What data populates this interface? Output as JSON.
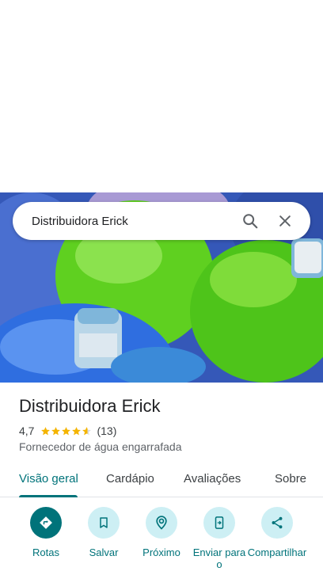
{
  "search": {
    "query": "Distribuidora Erick"
  },
  "place": {
    "name": "Distribuidora Erick",
    "rating": "4,7",
    "rating_value": 4.7,
    "review_count": "(13)",
    "category": "Fornecedor de água engarrafada"
  },
  "tabs": [
    {
      "label": "Visão geral",
      "active": true
    },
    {
      "label": "Cardápio",
      "active": false
    },
    {
      "label": "Avaliações",
      "active": false
    },
    {
      "label": "Sobre",
      "active": false
    }
  ],
  "actions": [
    {
      "label": "Rotas",
      "icon": "directions-icon"
    },
    {
      "label": "Salvar",
      "icon": "bookmark-icon"
    },
    {
      "label": "Próximo",
      "icon": "nearby-icon"
    },
    {
      "label": "Enviar para o",
      "icon": "send-to-phone-icon"
    },
    {
      "label": "Compartilhar",
      "icon": "share-icon"
    }
  ],
  "colors": {
    "accent": "#00737a",
    "action_bg": "#cdeff4",
    "star": "#f4b400"
  }
}
